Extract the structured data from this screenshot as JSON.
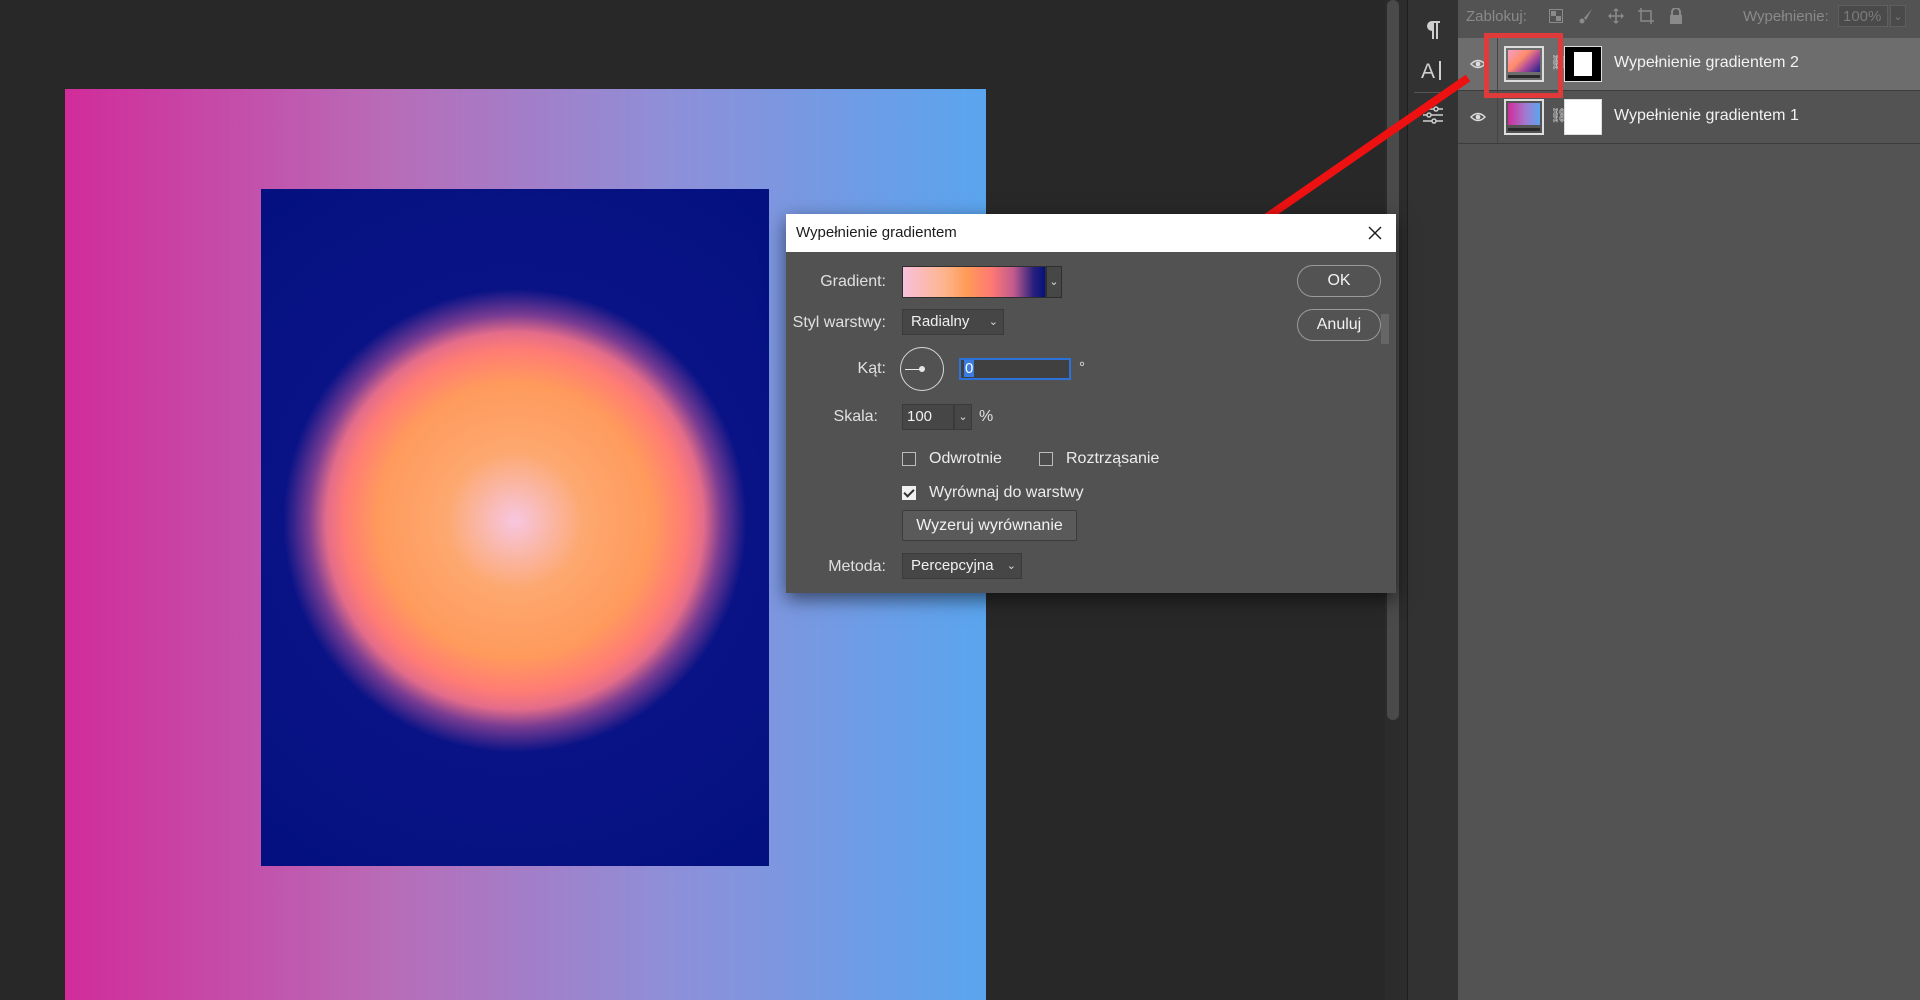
{
  "layers_panel": {
    "lock_label": "Zablokuj:",
    "fill_label": "Wypełnienie:",
    "fill_value": "100%",
    "layers": [
      {
        "name": "Wypełnienie gradientem 2",
        "selected": true
      },
      {
        "name": "Wypełnienie gradientem 1",
        "selected": false
      }
    ]
  },
  "tools": [
    "pilcrow-icon",
    "character-icon",
    "adjustments-icon"
  ],
  "dialog": {
    "title": "Wypełnienie gradientem",
    "gradient_label": "Gradient:",
    "style_label": "Styl warstwy:",
    "style_value": "Radialny",
    "angle_label": "Kąt:",
    "angle_value": "0",
    "angle_unit": "°",
    "scale_label": "Skala:",
    "scale_value": "100",
    "scale_unit": "%",
    "reverse_label": "Odwrotnie",
    "reverse_checked": false,
    "dither_label": "Roztrząsanie",
    "dither_checked": false,
    "align_label": "Wyrównaj do warstwy",
    "align_checked": true,
    "reset_align_label": "Wyzeruj wyrównanie",
    "method_label": "Metoda:",
    "method_value": "Percepcyjna",
    "ok_label": "OK",
    "cancel_label": "Anuluj"
  },
  "colors": {
    "accent": "#2d72d9",
    "highlight": "#e03a3a",
    "panel": "#535353",
    "canvas_bg": "#282828"
  }
}
